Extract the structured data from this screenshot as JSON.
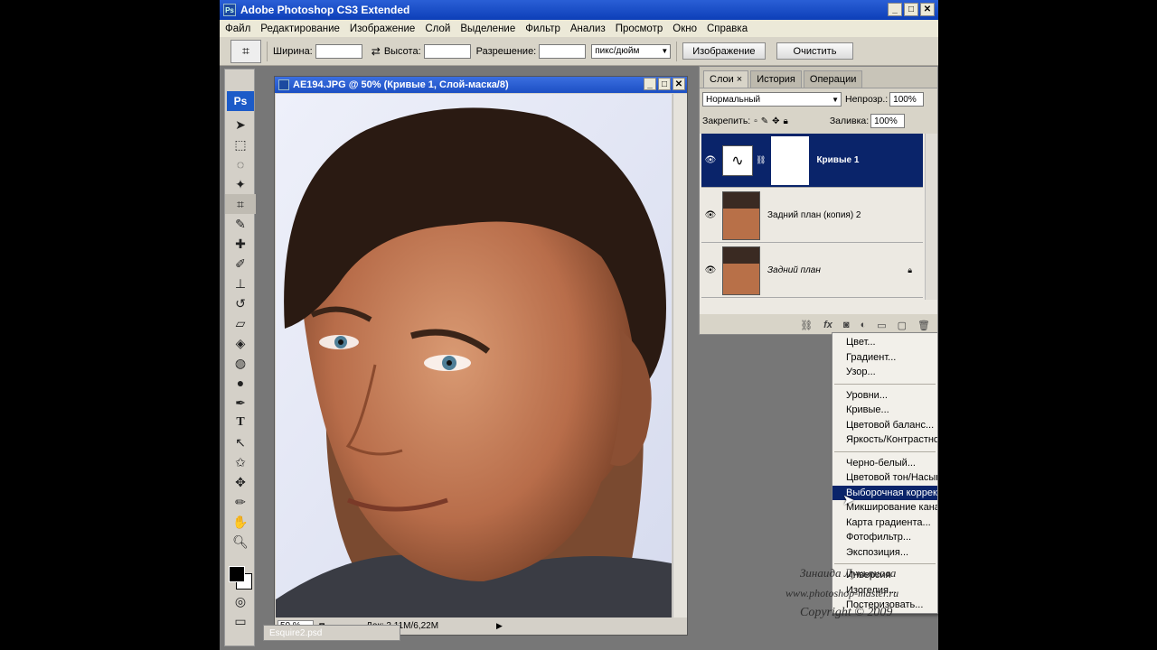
{
  "app": {
    "title": "Adobe Photoshop CS3 Extended",
    "badge": "Ps"
  },
  "menubar": [
    "Файл",
    "Редактирование",
    "Изображение",
    "Слой",
    "Выделение",
    "Фильтр",
    "Анализ",
    "Просмотр",
    "Окно",
    "Справка"
  ],
  "options": {
    "width_label": "Ширина:",
    "height_label": "Высота:",
    "resolution_label": "Разрешение:",
    "units": "пикс/дюйм",
    "image_button": "Изображение",
    "clear_button": "Очистить"
  },
  "document": {
    "title": "AE194.JPG @ 50% (Кривые 1, Слой-маска/8)",
    "zoom": "50 %",
    "doc_info": "Док: 3,11M/6,22M",
    "minimized_doc": "Esquire2.psd"
  },
  "layers_panel": {
    "tabs": [
      "Слои ×",
      "История",
      "Операции"
    ],
    "blend_mode": "Нормальный",
    "opacity_label": "Непрозр.:",
    "opacity_value": "100%",
    "lock_label": "Закрепить:",
    "fill_label": "Заливка:",
    "fill_value": "100%",
    "layers": [
      {
        "name": "Кривые 1",
        "selected": true
      },
      {
        "name": "Задний план (копия) 2",
        "selected": false
      },
      {
        "name": "Задний план",
        "selected": false
      }
    ]
  },
  "adjust_menu": {
    "group1": [
      "Цвет...",
      "Градиент...",
      "Узор..."
    ],
    "group2": [
      "Уровни...",
      "Кривые...",
      "Цветовой баланс...",
      "Яркость/Контрастность..."
    ],
    "group3": [
      "Черно-белый...",
      "Цветовой тон/Насыщенность...",
      "Выборочная коррекция цвета...",
      "Микширование каналов...",
      "Карта градиента...",
      "Фотофильтр...",
      "Экспозиция..."
    ],
    "group4": [
      "Инверсия",
      "Изогелия...",
      "Постеризовать..."
    ],
    "highlighted": "Выборочная коррекция цвета..."
  },
  "watermark": {
    "line1": "Зинаида Лукьянова",
    "line2": "www.photoshop-master.ru",
    "line3": "Copyright © 2009"
  },
  "colors": {
    "title_bar": "#0d3fb8",
    "selection": "#0a246a",
    "workspace": "#777777"
  }
}
